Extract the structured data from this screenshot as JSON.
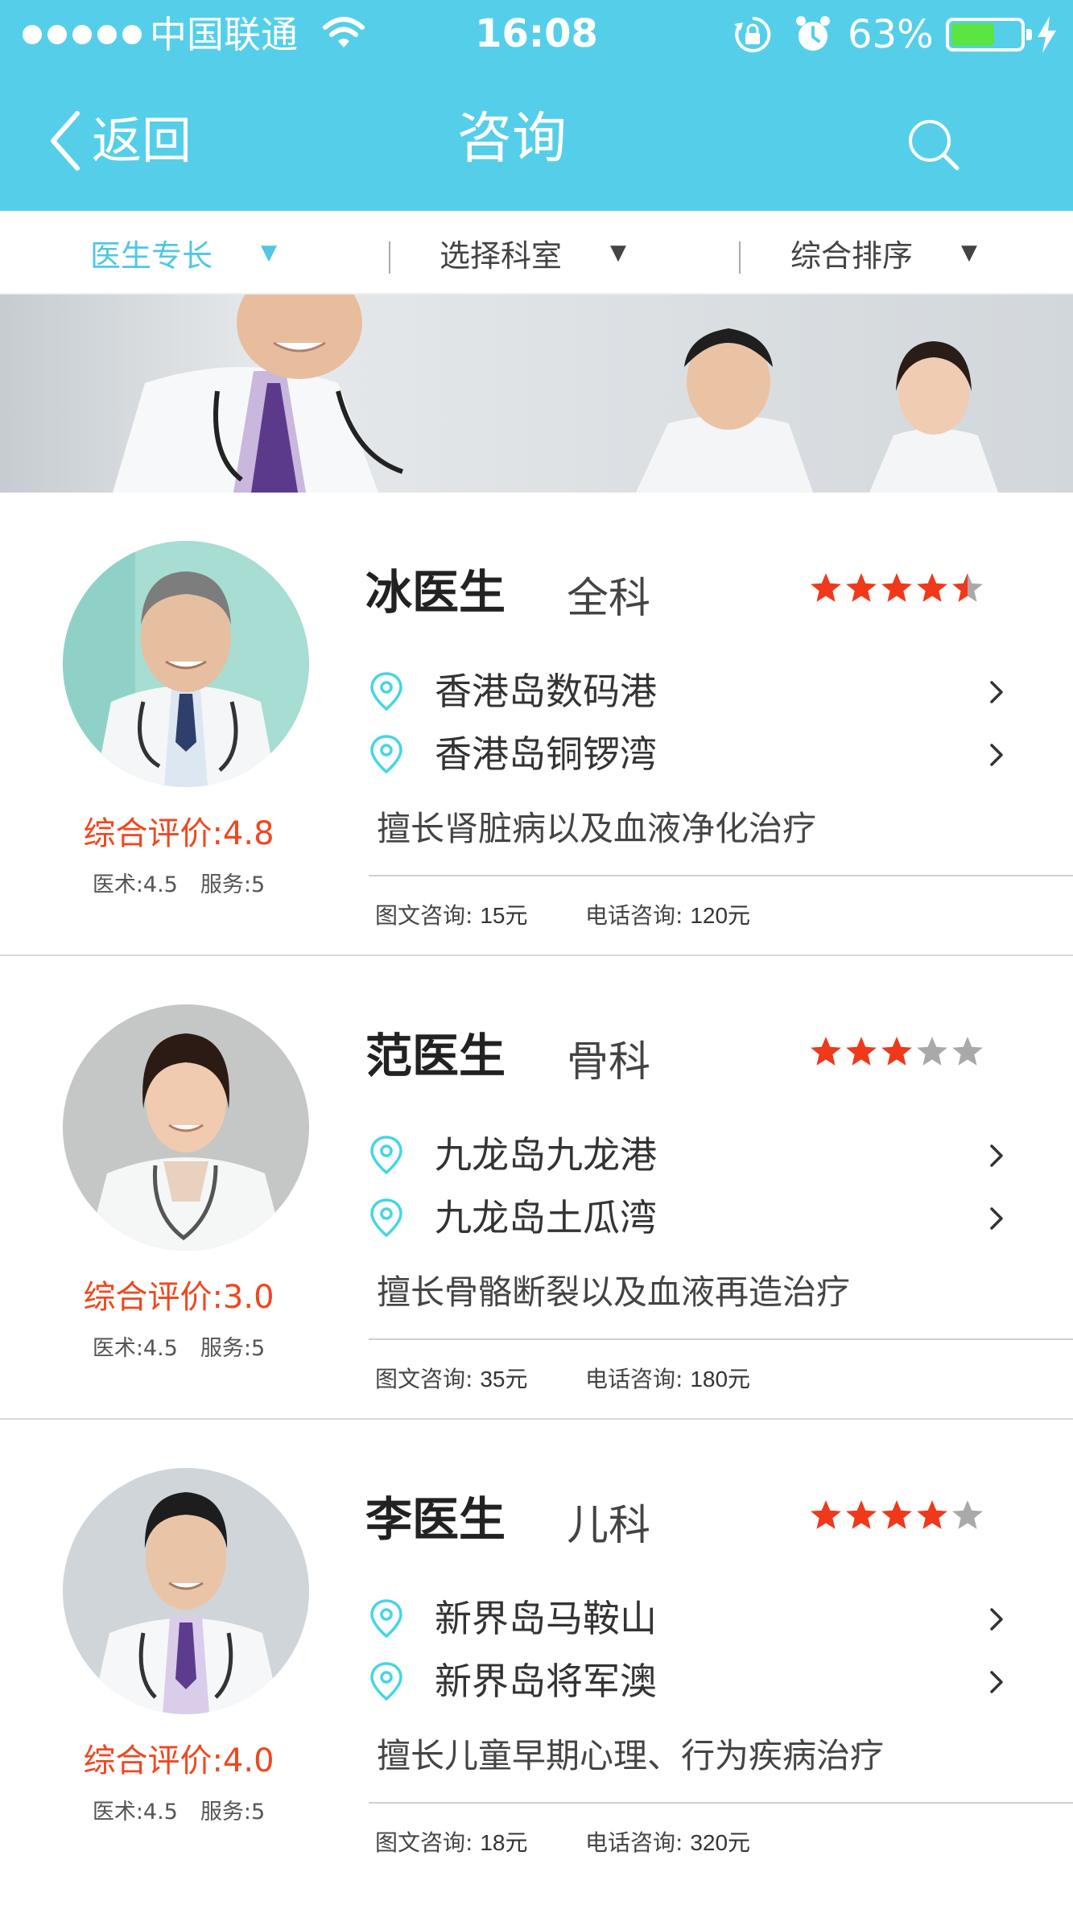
{
  "status_bar": {
    "carrier": "中国联通",
    "time": "16:08",
    "battery": "63%",
    "battery_level": 0.63,
    "battery_color": "#5be545"
  },
  "nav": {
    "back_label": "返回",
    "title": "咨询",
    "search_icon": "search-icon",
    "color": "#55cfe9"
  },
  "filters": [
    {
      "label": "医生专长",
      "caret": "▼",
      "active": true
    },
    {
      "label": "选择科室",
      "caret": "▼",
      "active": false
    },
    {
      "label": "综合排序",
      "caret": "▼",
      "active": false
    }
  ],
  "doctors": [
    {
      "name": "冰医生",
      "dept": "全科",
      "rating_stars": 4.5,
      "locations": [
        "香港岛数码港",
        "香港岛铜锣湾"
      ],
      "specialty": "擅长肾脏病以及血液净化治疗",
      "overall": "综合评价:4.8",
      "skill": "医术:4.5",
      "service": "服务:5",
      "text_consult_label": "图文咨询: ",
      "text_consult_price": "15元",
      "phone_consult_label": "电话咨询: ",
      "phone_consult_price": "120元"
    },
    {
      "name": "范医生",
      "dept": "骨科",
      "rating_stars": 3,
      "locations": [
        "九龙岛九龙港",
        "九龙岛土瓜湾"
      ],
      "specialty": "擅长骨骼断裂以及血液再造治疗",
      "overall": "综合评价:3.0",
      "skill": "医术:4.5",
      "service": "服务:5",
      "text_consult_label": "图文咨询: ",
      "text_consult_price": "35元",
      "phone_consult_label": "电话咨询: ",
      "phone_consult_price": "180元"
    },
    {
      "name": "李医生",
      "dept": "儿科",
      "rating_stars": 4,
      "locations": [
        "新界岛马鞍山",
        "新界岛将军澳"
      ],
      "specialty": "擅长儿童早期心理、行为疾病治疗",
      "overall": "综合评价:4.0",
      "skill": "医术:4.5",
      "service": "服务:5",
      "text_consult_label": "图文咨询: ",
      "text_consult_price": "18元",
      "phone_consult_label": "电话咨询: ",
      "phone_consult_price": "320元"
    }
  ],
  "colors": {
    "accent": "#4fc7e4",
    "star_on": "#f0381b",
    "star_off": "#a9a9a9",
    "rating_text": "#f0471e"
  }
}
